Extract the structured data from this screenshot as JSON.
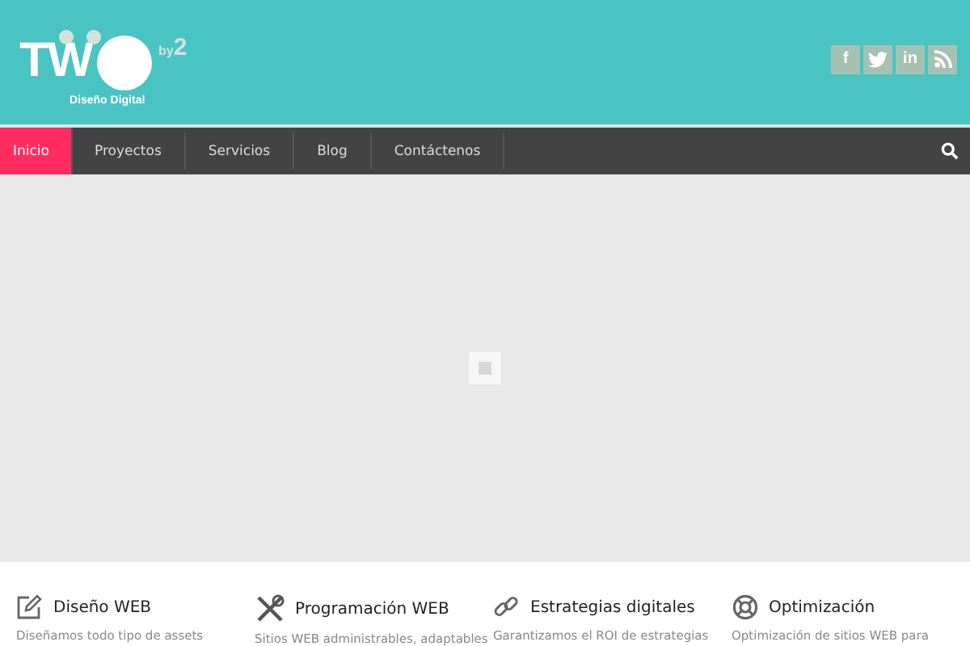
{
  "logo": {
    "letters": "TW",
    "by": "by",
    "superscript": "2",
    "tagline": "Diseño Digital"
  },
  "social": [
    {
      "kind": "facebook",
      "label": "f"
    },
    {
      "kind": "twitter"
    },
    {
      "kind": "linkedin",
      "label": "in"
    },
    {
      "kind": "rss"
    }
  ],
  "nav": [
    {
      "label": "Inicio",
      "selected": true
    },
    {
      "label": "Proyectos",
      "selected": false
    },
    {
      "label": "Servicios",
      "selected": false
    },
    {
      "label": "Blog",
      "selected": false
    },
    {
      "label": "Contáctenos",
      "selected": false
    }
  ],
  "features": [
    {
      "kind": "edit",
      "title": "Diseño WEB",
      "text": "Diseñamos todo tipo de assets"
    },
    {
      "kind": "tools",
      "title": "Programación WEB",
      "text": "Sitios WEB administrables, adaptables"
    },
    {
      "kind": "link",
      "title": "Estrategias digitales",
      "text": "Garantizamos el ROI de estrategias"
    },
    {
      "kind": "lifebuoy",
      "title": "Optimización",
      "text": "Optimización de sitios WEB para"
    }
  ]
}
